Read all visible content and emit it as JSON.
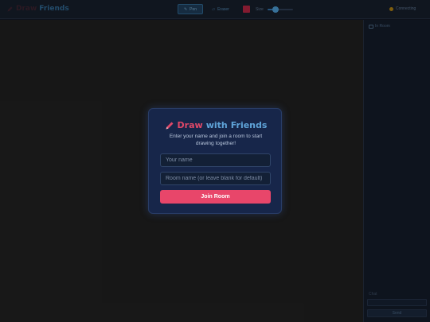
{
  "header": {
    "brand_draw": "Draw",
    "brand_friends": "Friends",
    "pen_label": "Pen",
    "eraser_label": "Eraser",
    "size_label": "Size",
    "size_fraction": 0.3,
    "color": "#c02040",
    "status_text": "Connecting"
  },
  "sidebar": {
    "title": "In Room",
    "chat_label": "Chat",
    "send_label": "Send"
  },
  "modal": {
    "title_draw": "Draw",
    "title_with": "with",
    "title_friends": "Friends",
    "description": "Enter your name and join a room to start drawing together!",
    "name_placeholder": "Your name",
    "room_placeholder": "Room name (or leave blank for default)",
    "join_label": "Join Room"
  },
  "colors": {
    "accent": "#e8466a",
    "brand_blue": "#5fa3d8",
    "canvas_bg": "#1a1a1a",
    "modal_bg": "#17264a"
  },
  "icons": {
    "brand": "pencil-icon",
    "pen": "pencil-icon",
    "eraser": "eraser-icon",
    "room": "users-icon"
  }
}
